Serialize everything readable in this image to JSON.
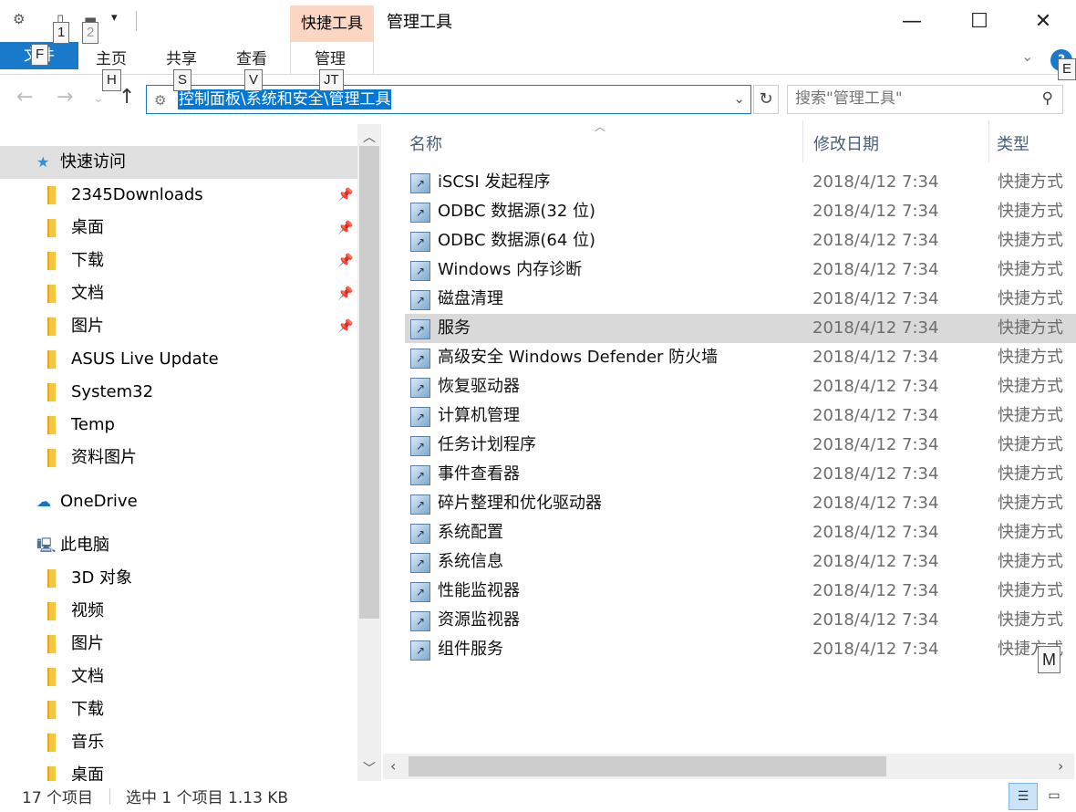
{
  "titlebar": {
    "context_tab": "快捷工具",
    "title": "管理工具",
    "qat_customize": "▾"
  },
  "ribbon": {
    "tabs": [
      {
        "label": "文件",
        "keytip": "F"
      },
      {
        "label": "主页",
        "keytip": "H"
      },
      {
        "label": "共享",
        "keytip": "S"
      },
      {
        "label": "查看",
        "keytip": "V"
      },
      {
        "label": "管理",
        "keytip": "JT"
      }
    ],
    "qat_keytips": [
      "1",
      "2"
    ],
    "help_keytip": "E",
    "help_label": "?"
  },
  "address": {
    "path": "控制面板\\系统和安全\\管理工具",
    "search_placeholder": "搜索\"管理工具\""
  },
  "nav": {
    "items": [
      {
        "label": "快速访问",
        "icon": "star-icon",
        "pinned": false
      },
      {
        "label": "2345Downloads",
        "icon": "folder-icon",
        "pinned": true
      },
      {
        "label": "桌面",
        "icon": "desktop-folder-icon",
        "pinned": true
      },
      {
        "label": "下载",
        "icon": "download-folder-icon",
        "pinned": true
      },
      {
        "label": "文档",
        "icon": "documents-folder-icon",
        "pinned": true
      },
      {
        "label": "图片",
        "icon": "pictures-folder-icon",
        "pinned": true
      },
      {
        "label": "ASUS Live Update",
        "icon": "folder-icon",
        "pinned": false
      },
      {
        "label": "System32",
        "icon": "folder-icon",
        "pinned": false
      },
      {
        "label": "Temp",
        "icon": "folder-icon",
        "pinned": false
      },
      {
        "label": "资料图片",
        "icon": "folder-icon",
        "pinned": false
      },
      {
        "label": "OneDrive",
        "icon": "cloud-icon",
        "pinned": false
      },
      {
        "label": "此电脑",
        "icon": "computer-icon",
        "pinned": false
      },
      {
        "label": "3D 对象",
        "icon": "3d-objects-folder-icon",
        "pinned": false
      },
      {
        "label": "视频",
        "icon": "videos-folder-icon",
        "pinned": false
      },
      {
        "label": "图片",
        "icon": "pictures-folder-icon",
        "pinned": false
      },
      {
        "label": "文档",
        "icon": "documents-folder-icon",
        "pinned": false
      },
      {
        "label": "下载",
        "icon": "download-folder-icon",
        "pinned": false
      },
      {
        "label": "音乐",
        "icon": "music-folder-icon",
        "pinned": false
      },
      {
        "label": "桌面",
        "icon": "desktop-folder-icon",
        "pinned": false
      }
    ]
  },
  "files": {
    "columns": [
      "名称",
      "修改日期",
      "类型"
    ],
    "rows": [
      {
        "name": "iSCSI 发起程序",
        "date": "2018/4/12 7:34",
        "type": "快捷方式"
      },
      {
        "name": "ODBC 数据源(32 位)",
        "date": "2018/4/12 7:34",
        "type": "快捷方式"
      },
      {
        "name": "ODBC 数据源(64 位)",
        "date": "2018/4/12 7:34",
        "type": "快捷方式"
      },
      {
        "name": "Windows 内存诊断",
        "date": "2018/4/12 7:34",
        "type": "快捷方式"
      },
      {
        "name": "磁盘清理",
        "date": "2018/4/12 7:34",
        "type": "快捷方式"
      },
      {
        "name": "服务",
        "date": "2018/4/12 7:34",
        "type": "快捷方式"
      },
      {
        "name": "高级安全 Windows Defender 防火墙",
        "date": "2018/4/12 7:34",
        "type": "快捷方式"
      },
      {
        "name": "恢复驱动器",
        "date": "2018/4/12 7:34",
        "type": "快捷方式"
      },
      {
        "name": "计算机管理",
        "date": "2018/4/12 7:34",
        "type": "快捷方式"
      },
      {
        "name": "任务计划程序",
        "date": "2018/4/12 7:34",
        "type": "快捷方式"
      },
      {
        "name": "事件查看器",
        "date": "2018/4/12 7:34",
        "type": "快捷方式"
      },
      {
        "name": "碎片整理和优化驱动器",
        "date": "2018/4/12 7:34",
        "type": "快捷方式"
      },
      {
        "name": "系统配置",
        "date": "2018/4/12 7:34",
        "type": "快捷方式"
      },
      {
        "name": "系统信息",
        "date": "2018/4/12 7:34",
        "type": "快捷方式"
      },
      {
        "name": "性能监视器",
        "date": "2018/4/12 7:34",
        "type": "快捷方式"
      },
      {
        "name": "资源监视器",
        "date": "2018/4/12 7:34",
        "type": "快捷方式"
      },
      {
        "name": "组件服务",
        "date": "2018/4/12 7:34",
        "type": "快捷方式"
      }
    ],
    "selected_index": 5,
    "floating_keytip": "M"
  },
  "status": {
    "count": "17 个项目",
    "selection": "选中 1 个项目  1.13 KB"
  },
  "colors": {
    "accent": "#1979ca",
    "selection": "#0078d7",
    "context_tab": "#fcd6c2"
  }
}
